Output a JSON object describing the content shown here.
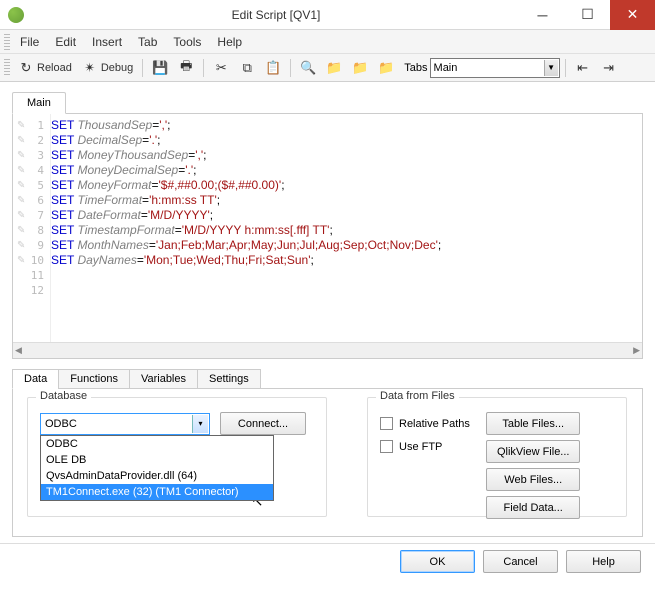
{
  "window": {
    "title": "Edit Script [QV1]"
  },
  "menus": [
    "File",
    "Edit",
    "Insert",
    "Tab",
    "Tools",
    "Help"
  ],
  "toolbar": {
    "reload": "Reload",
    "debug": "Debug",
    "tabs_label": "Tabs",
    "tabs_value": "Main"
  },
  "editor": {
    "tab": "Main",
    "lines": [
      {
        "kw": "SET",
        "var": "ThousandSep",
        "val": "','"
      },
      {
        "kw": "SET",
        "var": "DecimalSep",
        "val": "'.'"
      },
      {
        "kw": "SET",
        "var": "MoneyThousandSep",
        "val": "','"
      },
      {
        "kw": "SET",
        "var": "MoneyDecimalSep",
        "val": "'.'"
      },
      {
        "kw": "SET",
        "var": "MoneyFormat",
        "val": "'$#,##0.00;($#,##0.00)'"
      },
      {
        "kw": "SET",
        "var": "TimeFormat",
        "val": "'h:mm:ss TT'"
      },
      {
        "kw": "SET",
        "var": "DateFormat",
        "val": "'M/D/YYYY'"
      },
      {
        "kw": "SET",
        "var": "TimestampFormat",
        "val": "'M/D/YYYY h:mm:ss[.fff] TT'"
      },
      {
        "kw": "SET",
        "var": "MonthNames",
        "val": "'Jan;Feb;Mar;Apr;May;Jun;Jul;Aug;Sep;Oct;Nov;Dec'"
      },
      {
        "kw": "SET",
        "var": "DayNames",
        "val": "'Mon;Tue;Wed;Thu;Fri;Sat;Sun'"
      }
    ]
  },
  "lower_tabs": [
    "Data",
    "Functions",
    "Variables",
    "Settings"
  ],
  "database": {
    "legend": "Database",
    "selected": "ODBC",
    "options": [
      "ODBC",
      "OLE DB",
      "QvsAdminDataProvider.dll  (64)",
      "TM1Connect.exe  (32) (TM1 Connector)"
    ],
    "connect_btn": "Connect..."
  },
  "data_from_files": {
    "legend": "Data from Files",
    "relative_paths": "Relative Paths",
    "use_ftp": "Use FTP",
    "buttons": [
      "Table Files...",
      "QlikView File...",
      "Web Files...",
      "Field Data..."
    ]
  },
  "bottom": {
    "ok": "OK",
    "cancel": "Cancel",
    "help": "Help"
  }
}
